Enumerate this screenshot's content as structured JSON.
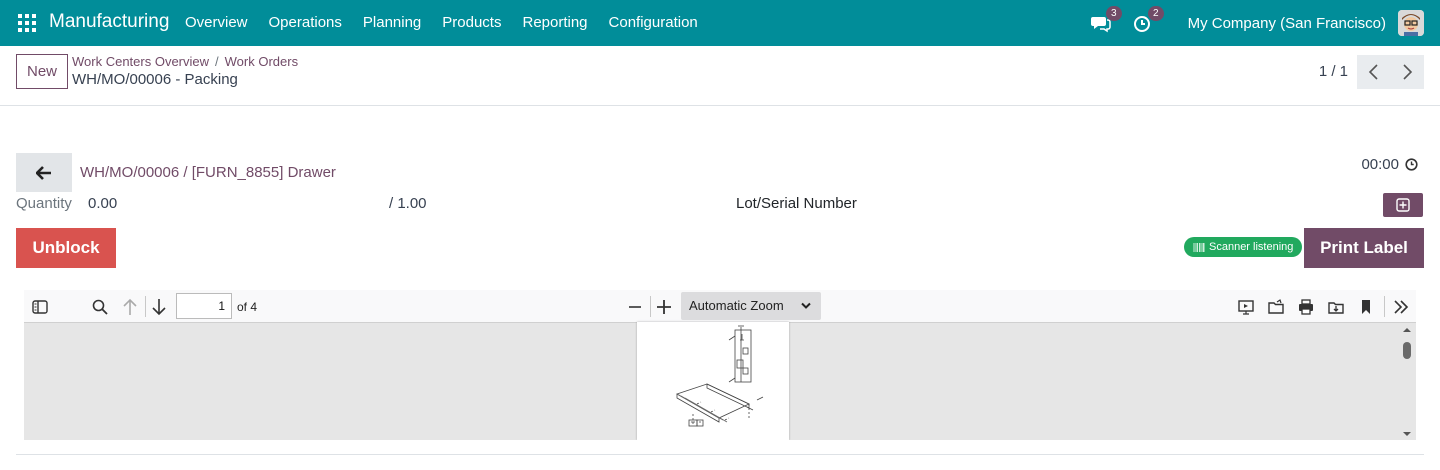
{
  "navbar": {
    "app_title": "Manufacturing",
    "menu": [
      "Overview",
      "Operations",
      "Planning",
      "Products",
      "Reporting",
      "Configuration"
    ],
    "messages_count": "3",
    "activities_count": "2",
    "company": "My Company (San Francisco)"
  },
  "control_panel": {
    "new_label": "New",
    "breadcrumb": [
      "Work Centers Overview",
      "Work Orders"
    ],
    "record_title": "WH/MO/00006 - Packing",
    "pager": "1 / 1"
  },
  "workorder": {
    "link": "WH/MO/00006 / [FURN_8855] Drawer",
    "timer": "00:00",
    "quantity_label": "Quantity",
    "quantity_value": "0.00",
    "quantity_total": "/ 1.00",
    "lot_label": "Lot/Serial Number",
    "unblock_label": "Unblock",
    "scanner_label": "Scanner listening",
    "print_label": "Print Label"
  },
  "pdf_viewer": {
    "current_page": "1",
    "page_count_label": "of 4",
    "zoom_label": "Automatic Zoom"
  },
  "colors": {
    "navbar": "#018d99",
    "primary": "#714b67",
    "danger": "#d9534f",
    "success": "#21a95e"
  }
}
